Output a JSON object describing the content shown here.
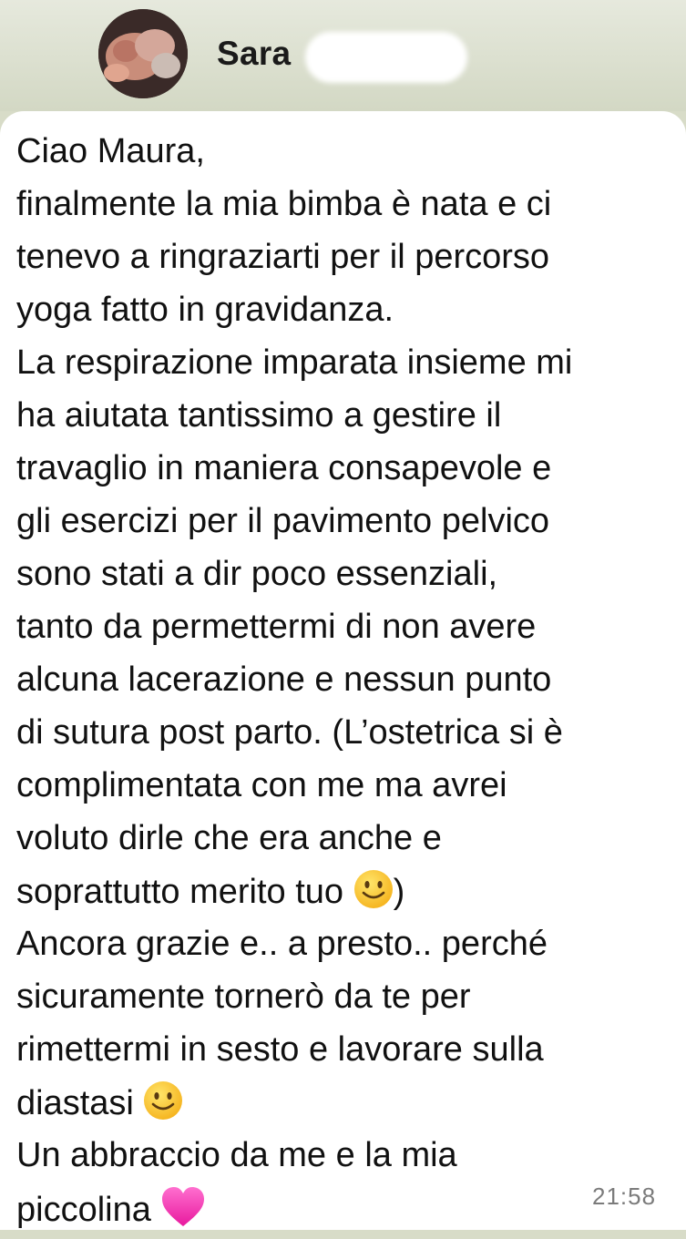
{
  "chat": {
    "contact_name": "Sara"
  },
  "message": {
    "lines": [
      "Ciao Maura,",
      "finalmente la mia bimba è nata e ci",
      "tenevo a ringraziarti per il percorso",
      "yoga fatto in gravidanza.",
      "La respirazione imparata insieme mi",
      "ha aiutata tantissimo a gestire il",
      "travaglio in maniera consapevole e",
      "gli esercizi per il pavimento pelvico",
      "sono stati a dir poco essenziali,",
      "tanto da permettermi di non avere",
      "alcuna lacerazione e nessun punto",
      "di sutura post parto. (L’ostetrica si è",
      "complimentata con me ma avrei",
      "voluto dirle che era anche e",
      "soprattutto merito tuo",
      ")",
      "Ancora grazie e.. a presto.. perché",
      "sicuramente tornerò da te per",
      "rimettermi in sesto e lavorare sulla",
      "diastasi",
      "Un abbraccio da me e la mia",
      "piccolina"
    ],
    "emojis": [
      "slightly-smiling-face",
      "slightly-smiling-face",
      "pink-heart"
    ],
    "time": "21:58"
  }
}
